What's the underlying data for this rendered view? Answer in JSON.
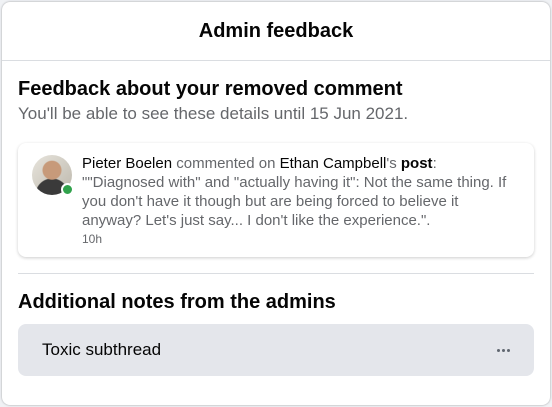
{
  "dialog": {
    "title": "Admin feedback"
  },
  "feedback": {
    "title": "Feedback about your removed comment",
    "subtitle": "You'll be able to see these details until 15 Jun 2021."
  },
  "comment": {
    "author": "Pieter Boelen",
    "action": " commented on ",
    "target": "Ethan Campbell",
    "possessive": "'s ",
    "post_label": "post",
    "colon": ":",
    "text": "\"\"Diagnosed with\" and \"actually having it\": Not the same thing. If you don't have it though but are being forced to believe it anyway? Let's just say... I don't like the experience.\".",
    "time": "10h",
    "status_color": "#31a24c"
  },
  "notes": {
    "title": "Additional notes from the admins",
    "items": [
      {
        "text": "Toxic subthread",
        "menu_icon": "more-horizontal-icon"
      }
    ]
  }
}
